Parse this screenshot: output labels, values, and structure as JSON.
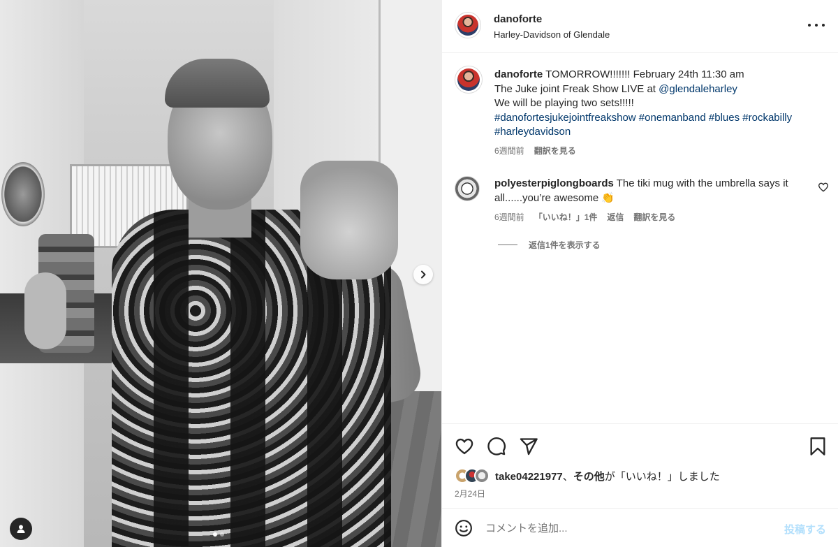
{
  "post": {
    "username": "danoforte",
    "location": "Harley-Davidson of Glendale",
    "caption": {
      "username": "danoforte",
      "line1": "TOMORROW!!!!!!! February 24th 11:30 am",
      "line2_prefix": "The Juke joint Freak Show LIVE at",
      "mention": "@glendaleharley",
      "line3": "We will be playing two sets!!!!!",
      "hashtags": [
        "#danofortesjukejointfreakshow",
        "#onemanband",
        "#blues",
        "#rockabilly",
        "#harleydavidson"
      ],
      "time": "6週間前",
      "translate": "翻訳を見る"
    },
    "comment": {
      "username": "polyesterpiglongboards",
      "text": "The tiki mug with the umbrella says it all......you’re awesome",
      "emoji": "👏",
      "time": "6週間前",
      "likes": "「いいね！」1件",
      "reply": "返信",
      "translate": "翻訳を見る",
      "view_replies": "返信1件を表示する"
    },
    "likes": {
      "user": "take04221977",
      "sep": "、",
      "others": "その他",
      "suffix": "が「いいね！」しました"
    },
    "date": "2月24日",
    "add_comment": {
      "placeholder": "コメントを追加...",
      "post_label": "投稿する"
    },
    "carousel": {
      "total_slides": 2,
      "current_slide": 1
    }
  },
  "icons": {
    "like": "heart-icon",
    "comment": "comment-bubble-icon",
    "share": "paper-plane-icon",
    "save": "bookmark-icon",
    "more": "more-options-icon",
    "next": "chevron-right-icon",
    "tag": "user-tag-icon",
    "emoji": "emoji-icon"
  },
  "colors": {
    "link": "#00376b",
    "secondary_text": "#737373",
    "post_disabled": "#b2dffc"
  }
}
